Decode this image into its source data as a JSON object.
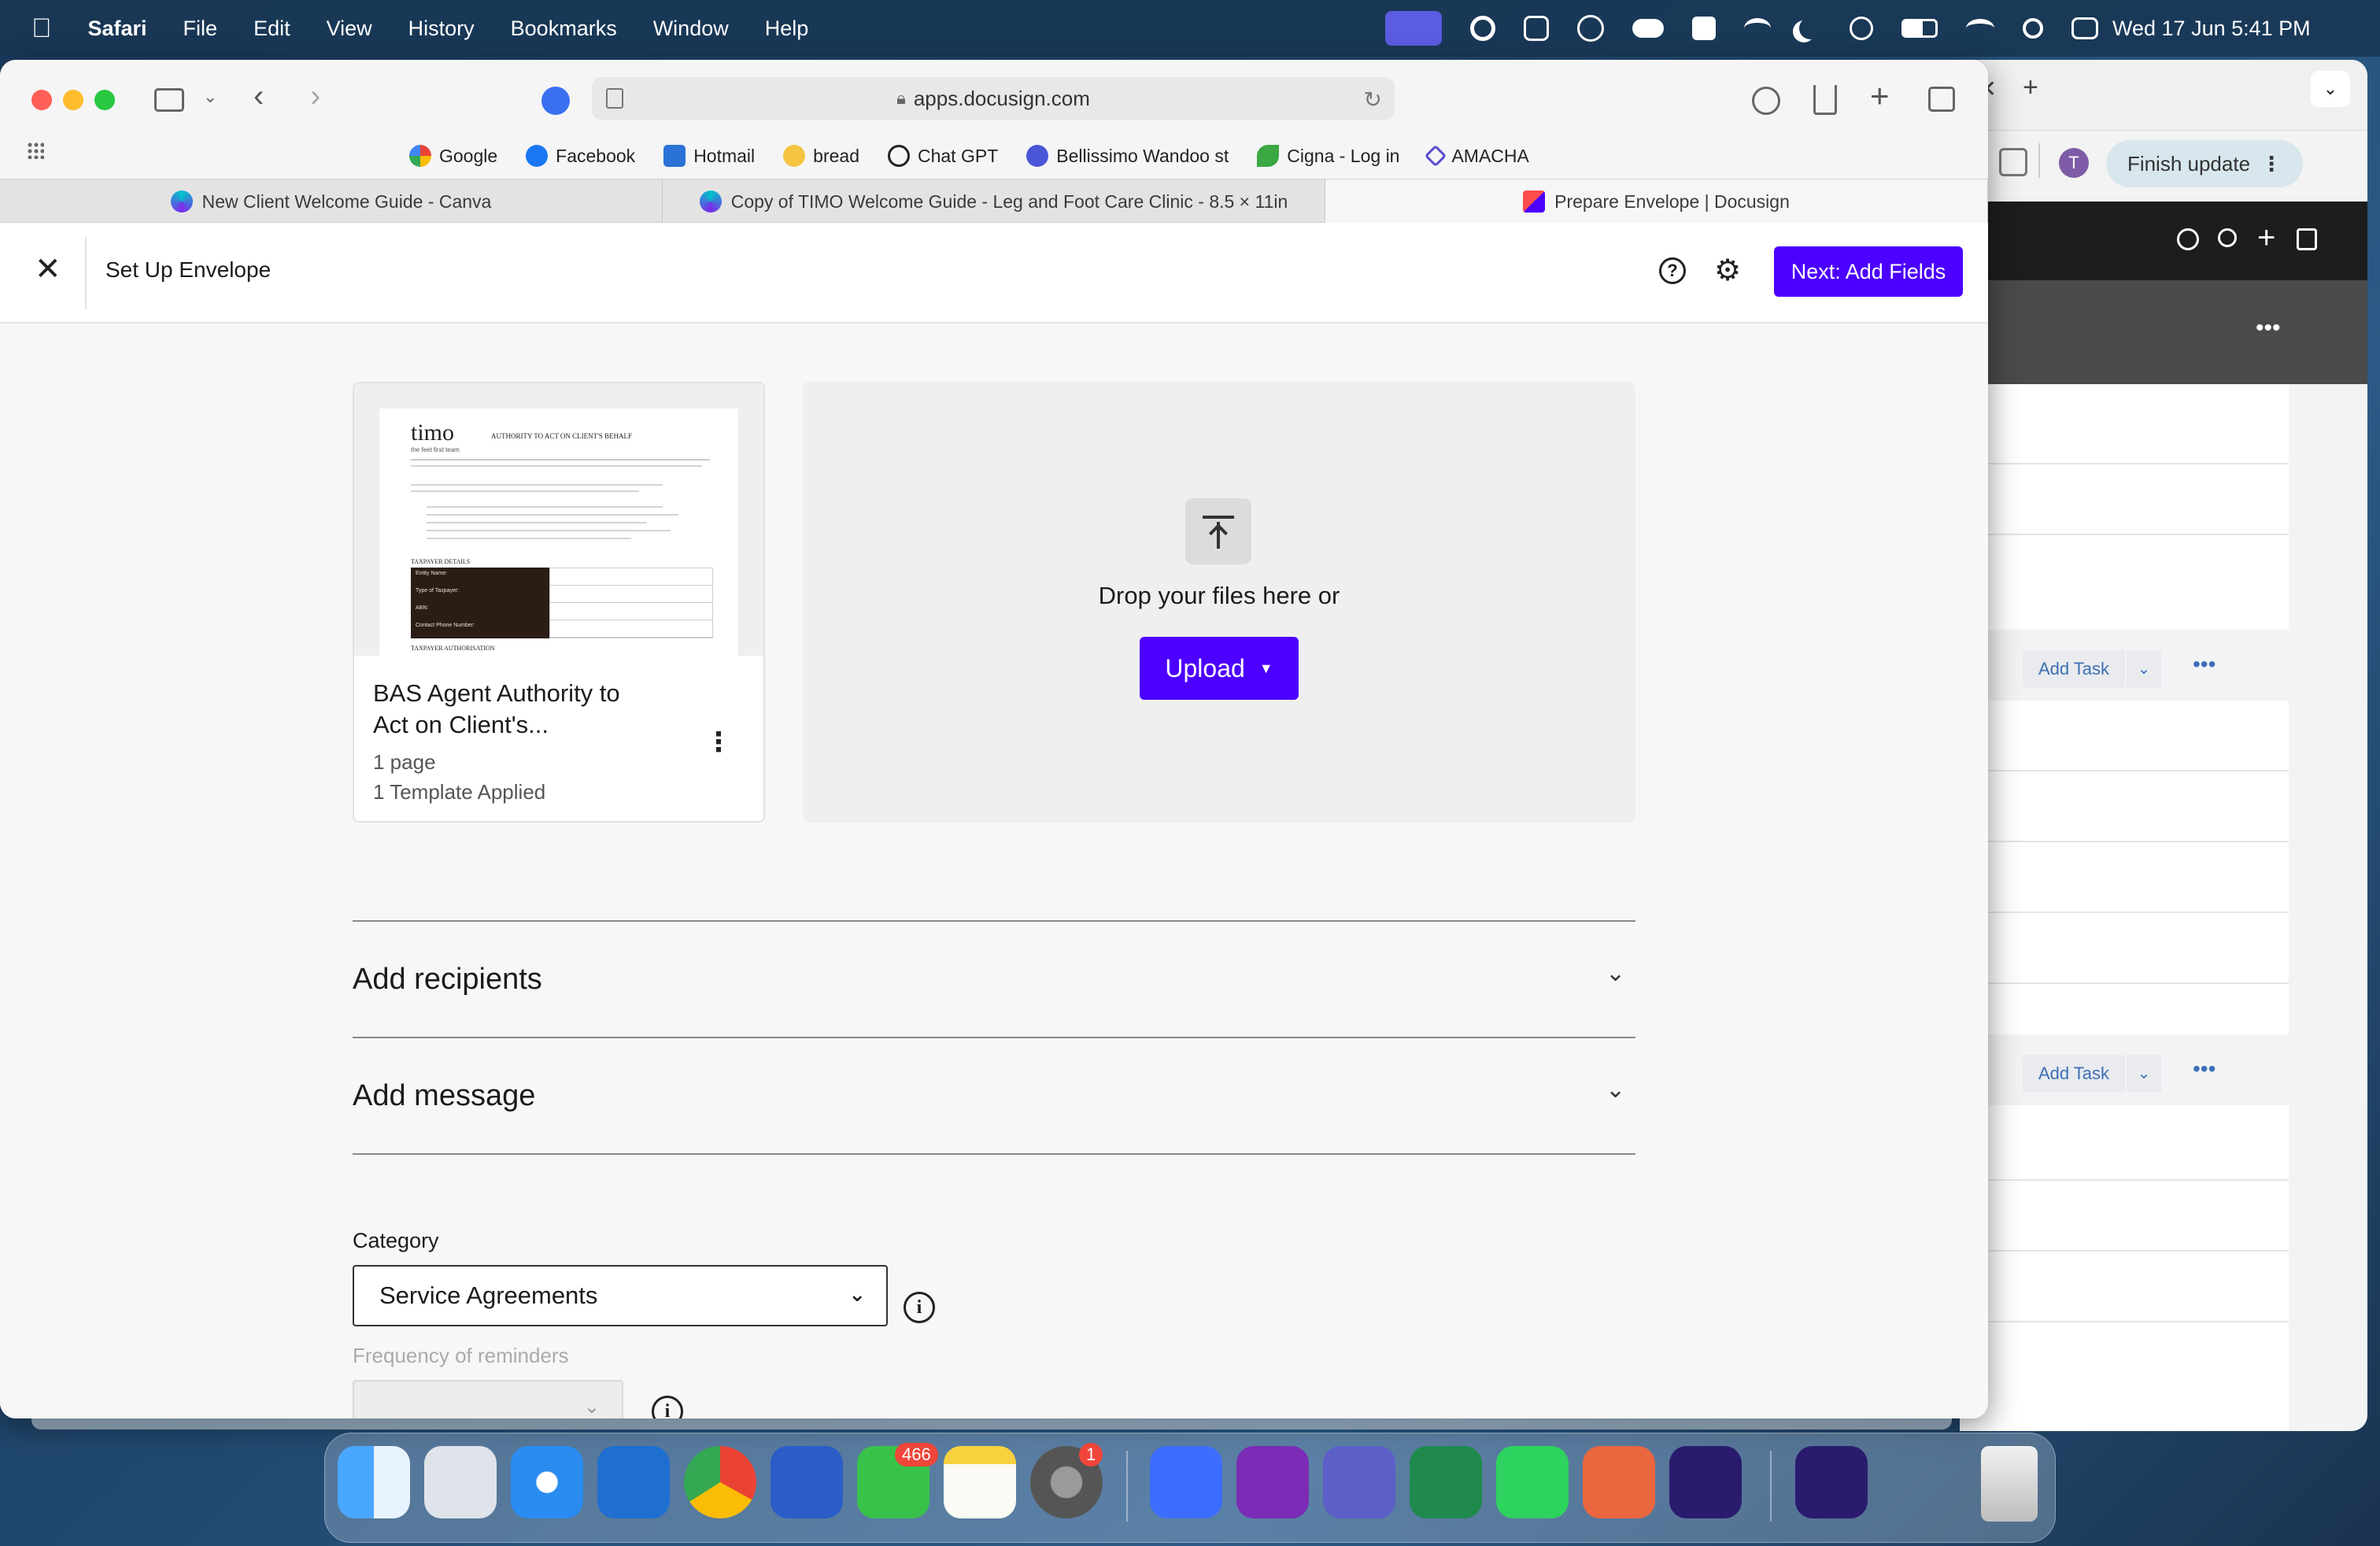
{
  "menubar": {
    "app": "Safari",
    "items": [
      "File",
      "Edit",
      "View",
      "History",
      "Bookmarks",
      "Window",
      "Help"
    ],
    "clock": "Wed 17 Jun  5:41 PM"
  },
  "browser": {
    "url": "apps.docusign.com",
    "bookmarks": [
      "Google",
      "Facebook",
      "Hotmail",
      "bread",
      "Chat GPT",
      "Bellissimo Wandoo st",
      "Cigna - Log in",
      "AMACHA"
    ],
    "tabs": [
      {
        "title": "New Client Welcome Guide - Canva",
        "active": false
      },
      {
        "title": "Copy of TIMO Welcome Guide - Leg and Foot Care Clinic - 8.5 × 11in",
        "active": false
      },
      {
        "title": "Prepare Envelope | Docusign",
        "active": true
      }
    ]
  },
  "second_window": {
    "finish_update": "Finish update",
    "avatar_letter": "T",
    "add_task_1": "Add Task",
    "add_task_2": "Add Task",
    "more": "•••"
  },
  "app": {
    "header_title": "Set Up Envelope",
    "next_button": "Next: Add Fields",
    "document": {
      "thumb_logo": "timo",
      "thumb_tagline": "the feet first team",
      "thumb_heading": "AUTHORITY TO ACT ON CLIENT'S BEHALF",
      "thumb_section1": "TAXPAYER DETAILS",
      "thumb_rows": [
        "Entity Name:",
        "Type of Taxpayer:",
        "ABN:",
        "Contact Phone Number:"
      ],
      "thumb_section2": "TAXPAYER AUTHORISATION",
      "title_line1": "BAS Agent Authority to",
      "title_line2": "Act on Client's...",
      "pages": "1 page",
      "templates": "1 Template Applied"
    },
    "drop_text": "Drop your files here or",
    "upload_button": "Upload",
    "sections": [
      {
        "label": "Add recipients"
      },
      {
        "label": "Add message"
      }
    ],
    "category_label": "Category",
    "category_value": "Service Agreements",
    "reminders_label": "Frequency of reminders"
  },
  "dock": {
    "messages_badge": "466",
    "settings_badge": "1"
  },
  "colors": {
    "accent": "#4c00ff",
    "menubar": "#19375a"
  }
}
